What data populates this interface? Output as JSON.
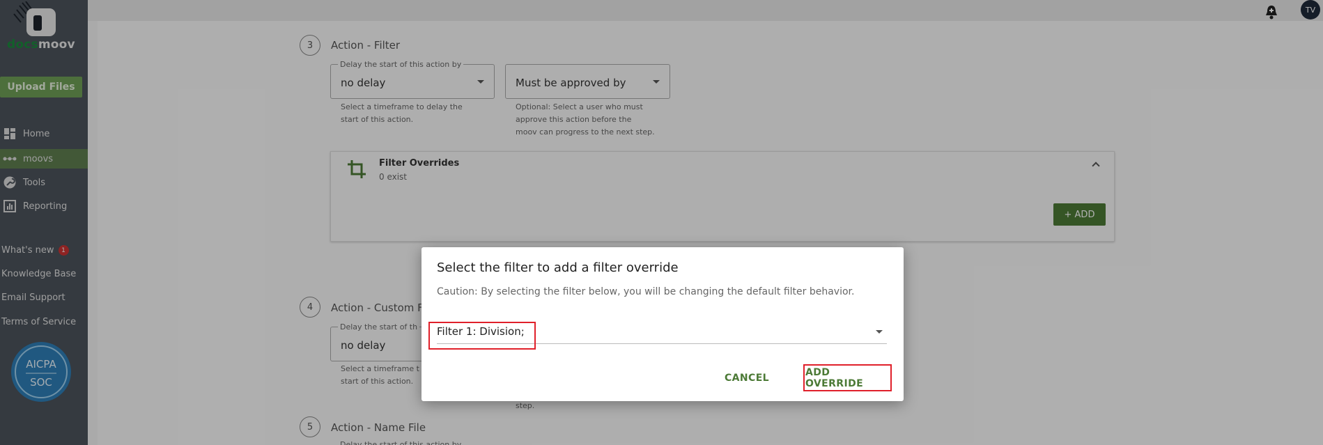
{
  "app": {
    "logo_text_green": "docs",
    "logo_text_white": "moov",
    "upload_label": "Upload Files",
    "certification": "AICPA SOC"
  },
  "sidebar": {
    "items": [
      {
        "label": "Home",
        "icon": "dashboard-icon"
      },
      {
        "label": "moovs",
        "icon": "dots-icon"
      },
      {
        "label": "Tools",
        "icon": "wrench-icon"
      },
      {
        "label": "Reporting",
        "icon": "chart-icon"
      }
    ],
    "links": [
      {
        "label": "What's new",
        "badge": "1"
      },
      {
        "label": "Knowledge Base"
      },
      {
        "label": "Email Support"
      },
      {
        "label": "Terms of Service"
      }
    ]
  },
  "topbar": {
    "avatar_initials": "TV"
  },
  "steps": [
    {
      "number": "3",
      "title": "Action - Filter",
      "delay_legend": "Delay the start of this action by",
      "delay_value": "no delay",
      "delay_helper": "Select a timeframe to delay the start of this action.",
      "approval_placeholder": "Must be approved by",
      "approval_helper": "Optional: Select a user who must approve this action before the moov can progress to the next step."
    },
    {
      "number": "4",
      "title": "Action - Custom F",
      "delay_legend": "Delay the start of th",
      "delay_value": "no delay",
      "delay_helper": "Select a timeframe t start of this action.",
      "approval_helper_tail": "step."
    },
    {
      "number": "5",
      "title": "Action - Name File",
      "delay_legend": "Delay the start of this action by"
    }
  ],
  "filter_overrides": {
    "title": "Filter Overrides",
    "count_text": "0 exist",
    "add_label": "+ ADD"
  },
  "dialog": {
    "title": "Select the filter to add a filter override",
    "caution": "Caution: By selecting the filter below, you will be changing the default filter behavior.",
    "selected_filter": "Filter 1: Division;",
    "cancel_label": "CANCEL",
    "add_override_label": "ADD OVERRIDE"
  },
  "colors": {
    "sidebar_bg": "#4c535c",
    "accent_green": "#4c7a36",
    "highlight_red": "#e0202a"
  }
}
